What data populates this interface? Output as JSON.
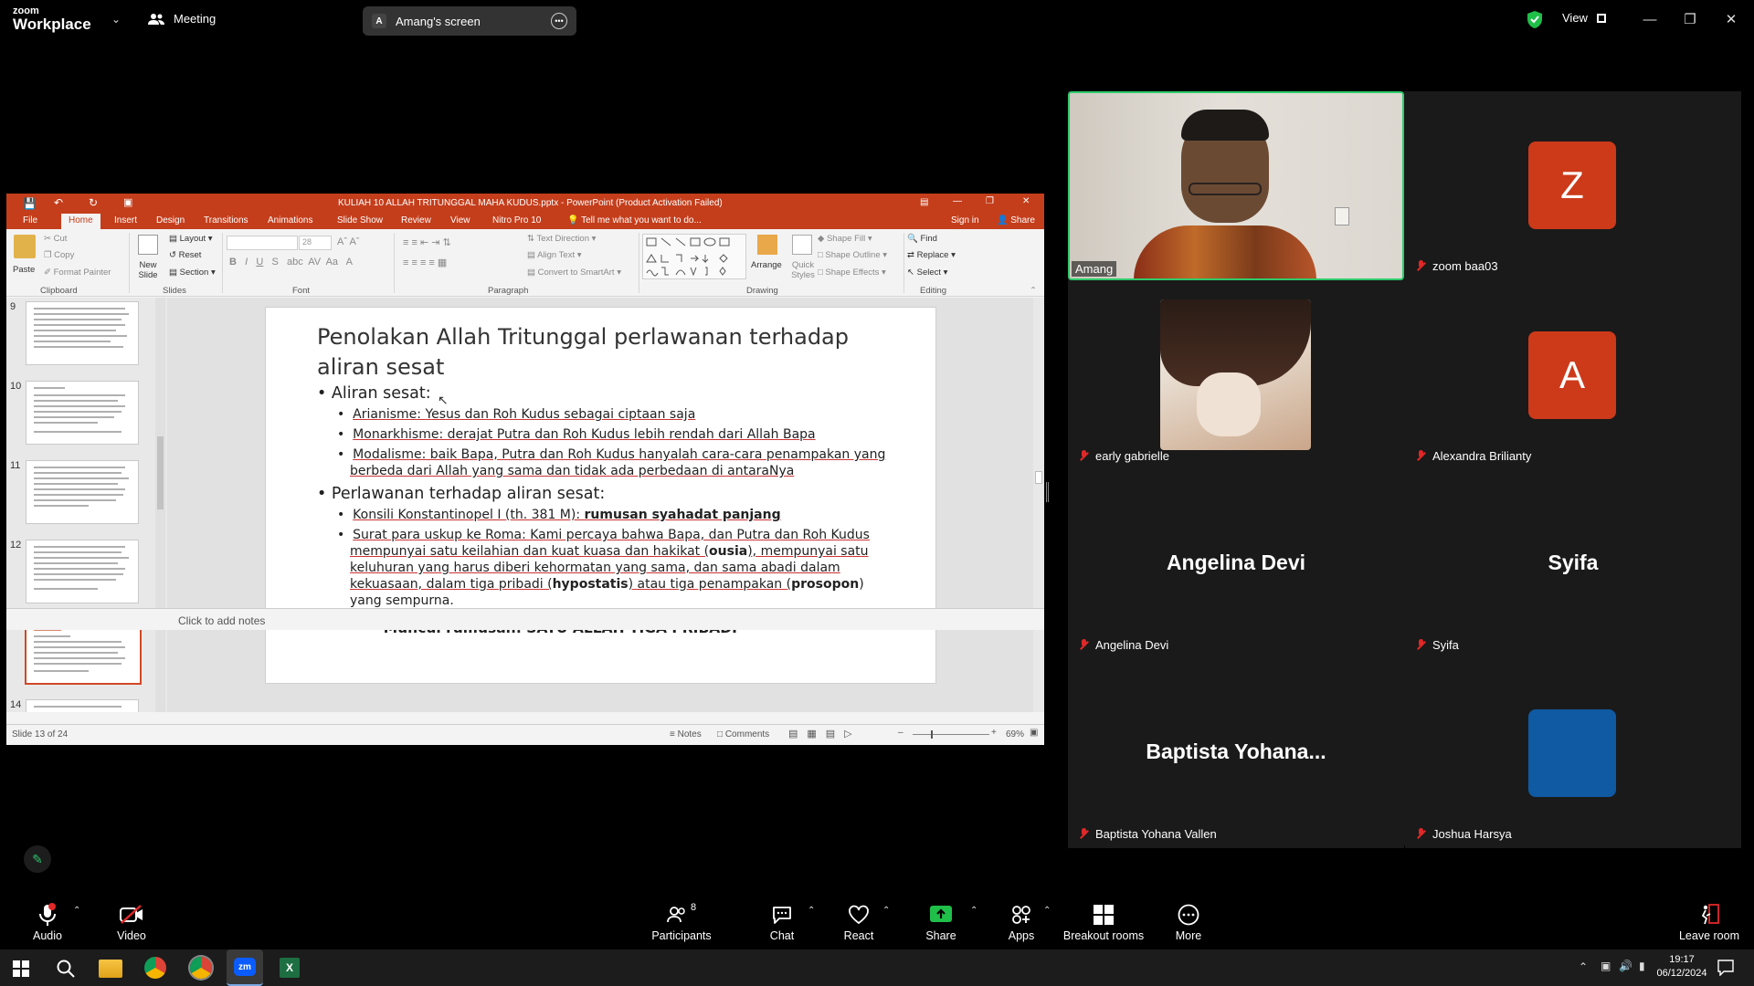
{
  "zoom": {
    "logo_top": "zoom",
    "logo_bottom": "Workplace",
    "meeting_label": "Meeting",
    "screen_share": {
      "avatar": "A",
      "label": "Amang's screen"
    },
    "view_label": "View"
  },
  "ppt": {
    "window_title": "KULIAH 10 ALLAH TRITUNGGAL MAHA KUDUS.pptx - PowerPoint (Product Activation Failed)",
    "menu": [
      "File",
      "Home",
      "Insert",
      "Design",
      "Transitions",
      "Animations",
      "Slide Show",
      "Review",
      "View",
      "Nitro Pro 10"
    ],
    "tell_me": "Tell me what you want to do...",
    "sign_in": "Sign in",
    "share": "Share",
    "ribbon": {
      "paste": "Paste",
      "cut": "Cut",
      "copy": "Copy",
      "format_painter": "Format Painter",
      "clipboard": "Clipboard",
      "new_slide": "New Slide",
      "layout": "Layout",
      "reset": "Reset",
      "section": "Section",
      "slides": "Slides",
      "font_size": "28",
      "font": "Font",
      "text_direction": "Text Direction",
      "align_text": "Align Text",
      "convert_smartart": "Convert to SmartArt",
      "paragraph": "Paragraph",
      "arrange": "Arrange",
      "quick_styles": "Quick Styles",
      "shape_fill": "Shape Fill",
      "shape_outline": "Shape Outline",
      "shape_effects": "Shape Effects",
      "drawing": "Drawing",
      "find": "Find",
      "replace": "Replace",
      "select": "Select",
      "editing": "Editing"
    },
    "thumbs": [
      "9",
      "10",
      "11",
      "12",
      "13",
      "14"
    ],
    "slide": {
      "title": "Penolakan Allah Tritunggal perlawanan terhadap aliran sesat",
      "bullet1": "Aliran sesat:",
      "sub1": [
        "Arianisme: Yesus dan Roh Kudus sebagai ciptaan saja",
        "Monarkhisme: derajat Putra dan Roh Kudus lebih rendah dari Allah Bapa",
        "Modalisme: baik Bapa, Putra dan Roh Kudus hanyalah cara-cara penampakan yang berbeda dari Allah yang sama dan tidak ada perbedaan di antaraNya"
      ],
      "bullet2": "Perlawanan terhadap aliran sesat:",
      "konsili_plain": "Konsili Konstantinopel I (th. 381 M): ",
      "konsili_bold": "rumusan syahadat panjang",
      "surat_1": "Surat para uskup ke Roma: Kami percaya bahwa Bapa, dan Putra dan Roh Kudus mempunyai satu keilahian dan kuat kuasa dan hakikat (",
      "surat_b1": "ousia",
      "surat_2": "), mempunyai satu keluhuran yang harus diberi kehormatan yang sama, dan sama abadi dalam kekuasaan, dalam tiga pribadi (",
      "surat_b2": "hypostatis",
      "surat_3": ") atau tiga penampakan (",
      "surat_b3": "prosopon",
      "surat_4": ") yang sempurna.",
      "muncul": "Muncul rumusan: SATU ALLAH TIGA PRIBADI"
    },
    "notes_placeholder": "Click to add notes",
    "status_slide": "Slide 13 of 24",
    "status_notes": "Notes",
    "status_comments": "Comments",
    "zoom_pct": "69%"
  },
  "participants": [
    {
      "name": "Amang",
      "type": "video"
    },
    {
      "name": "zoom baa03",
      "avatar": "Z",
      "color": "#cc3a1a"
    },
    {
      "name": "early gabrielle",
      "type": "image"
    },
    {
      "name": "Alexandra Brilianty",
      "avatar": "A",
      "color": "#cc3a1a"
    },
    {
      "name": "Angelina Devi",
      "big": "Angelina Devi"
    },
    {
      "name": "Syifa",
      "big": "Syifa"
    },
    {
      "name": "Baptista Yohana Vallen",
      "big": "Baptista  Yohana..."
    },
    {
      "name": "Joshua Harsya",
      "avatar": "",
      "color": "#0f5aa3"
    }
  ],
  "toolbar": {
    "audio": "Audio",
    "video": "Video",
    "participants": "Participants",
    "participants_count": "8",
    "chat": "Chat",
    "react": "React",
    "share": "Share",
    "apps": "Apps",
    "breakout": "Breakout rooms",
    "more": "More",
    "leave": "Leave room"
  },
  "taskbar": {
    "time": "19:17",
    "date": "06/12/2024"
  }
}
